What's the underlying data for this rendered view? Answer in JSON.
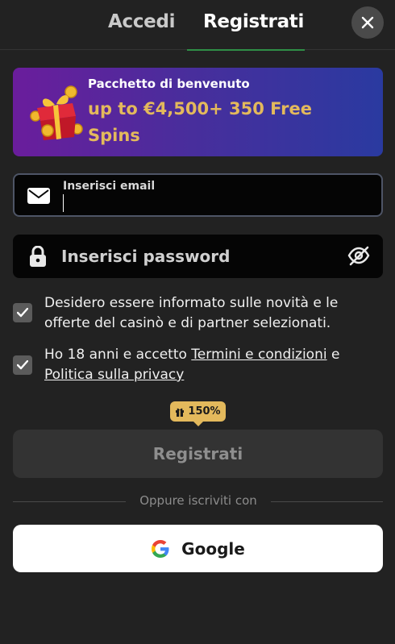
{
  "tabs": {
    "login_label": "Accedi",
    "register_label": "Registrati"
  },
  "icons": {
    "close": "close-icon",
    "mail": "mail-icon",
    "lock": "lock-icon",
    "eye_off": "eye-off-icon",
    "gift": "gift-icon",
    "google": "google-icon",
    "check": "check-icon"
  },
  "promo": {
    "subtitle": "Pacchetto di benvenuto",
    "offer": "up to €4,500+ 350 Free Spins"
  },
  "form": {
    "email_label": "Inserisci email",
    "email_value": "",
    "password_placeholder": "Inserisci password",
    "password_value": ""
  },
  "consents": {
    "newsletter": {
      "checked": true,
      "text": "Desidero essere informato sulle novità e le offerte del casinò e di partner selezionati."
    },
    "terms": {
      "checked": true,
      "prefix": "Ho 18 anni e accetto ",
      "terms_link": "Termini e condizioni",
      "middle": " e ",
      "privacy_link": "Politica sulla privacy"
    }
  },
  "bonus_badge": "150%",
  "register_button": "Registrati",
  "divider_text": "Oppure iscriviti con",
  "google_button": "Google",
  "colors": {
    "background": "#222222",
    "accent_gold": "#e3b95c",
    "tab_underline": "#2f8f47",
    "promo_start": "#6a1d9c",
    "promo_end": "#2a3aa0"
  }
}
